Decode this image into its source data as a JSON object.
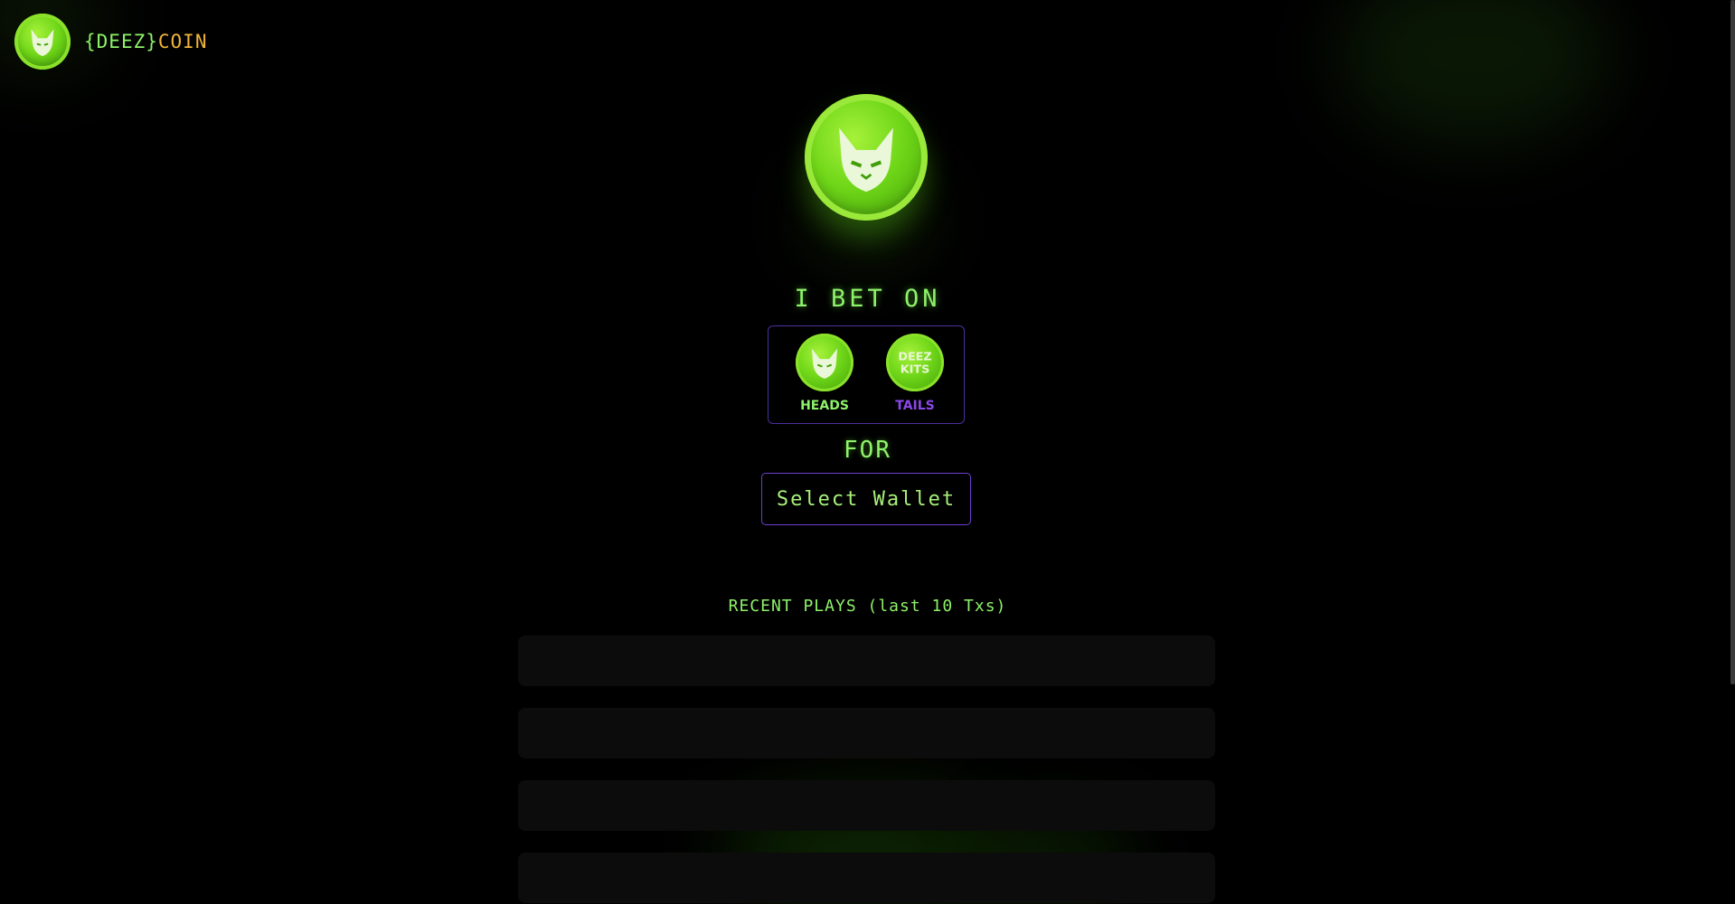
{
  "brand": {
    "open_brace": "{",
    "deez": "DEEZ",
    "close_brace": "}",
    "coin_word": "COIN"
  },
  "game": {
    "bet_title": "I BET ON",
    "heads_label": "HEADS",
    "tails_label": "TAILS",
    "tails_coin_text_top": "DEEZ",
    "tails_coin_text_bottom": "KITS",
    "for_title": "FOR",
    "wallet_button": "Select Wallet"
  },
  "recent": {
    "title": "RECENT PLAYS (last 10 Txs)"
  },
  "colors": {
    "accent_green": "#8ef26a",
    "coin_word": "#f0b43c",
    "tails_purple": "#8b48e8",
    "border_purple": "#4b2fa0"
  }
}
